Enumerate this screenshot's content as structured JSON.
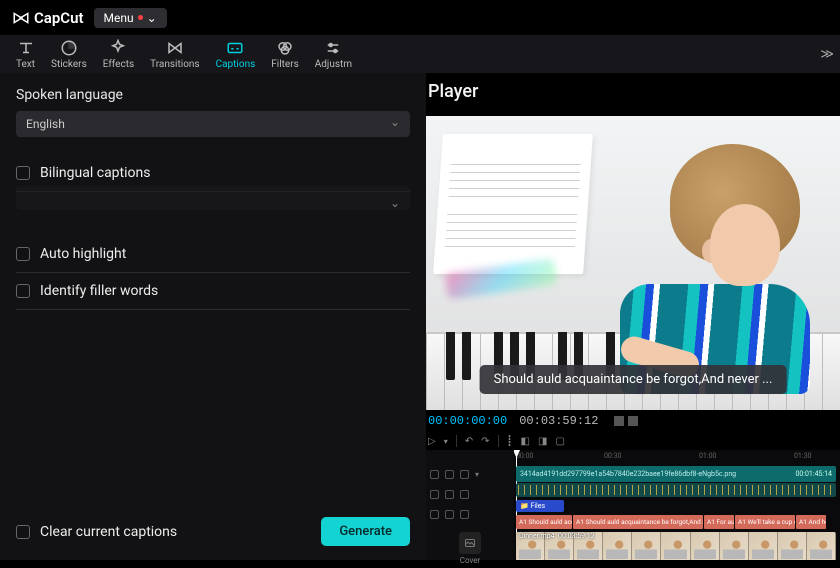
{
  "app": {
    "name": "CapCut",
    "menu_label": "Menu"
  },
  "toolbar": {
    "items": [
      {
        "label": "Text",
        "active": false
      },
      {
        "label": "Stickers",
        "active": false
      },
      {
        "label": "Effects",
        "active": false
      },
      {
        "label": "Transitions",
        "active": false
      },
      {
        "label": "Captions",
        "active": true
      },
      {
        "label": "Filters",
        "active": false
      },
      {
        "label": "Adjustm",
        "active": false
      }
    ]
  },
  "captions_panel": {
    "spoken_language_label": "Spoken language",
    "language_value": "English",
    "bilingual_label": "Bilingual captions",
    "auto_highlight_label": "Auto highlight",
    "filler_words_label": "Identify filler words",
    "clear_label": "Clear current captions",
    "generate_label": "Generate"
  },
  "player": {
    "title": "Player",
    "caption_text": "Should auld acquaintance be forgot,And never ..."
  },
  "timeline": {
    "current_tc": "00:00:00:00",
    "duration_tc": "00:03:59:12",
    "ruler": [
      "00:00",
      "00:30",
      "01:00",
      "01:30"
    ],
    "audio_clip_name": "3414ad4191dd297799e1a54b7840e232baee19fe86dbf8-eNgb5c.png",
    "audio_clip_dur": "00:01:45:14",
    "blue_clip": "Files",
    "caption_segments": [
      "Should auld acquai",
      "Should auld acquaintance be forgot,And neve",
      "For auld",
      "We'll take a cup of",
      "And he"
    ],
    "caption_prefix": "A1",
    "video_clip_name": "Dinner.mp4",
    "video_clip_dur": "00:03:59:12",
    "cover_label": "Cover"
  }
}
